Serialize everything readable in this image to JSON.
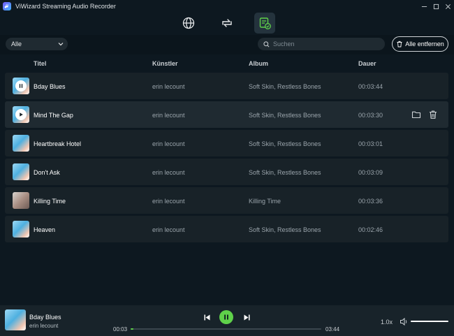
{
  "window": {
    "title": "ViWizard Streaming Audio Recorder"
  },
  "toolbar": {
    "filter_selected": "Alle",
    "search_placeholder": "Suchen",
    "remove_all_label": "Alle entfernen"
  },
  "columns": {
    "title": "Titel",
    "artist": "Künstler",
    "album": "Album",
    "duration": "Dauer"
  },
  "tracks": [
    {
      "title": "Bday Blues",
      "artist": "erin lecount",
      "album": "Soft Skin, Restless Bones",
      "duration": "00:03:44"
    },
    {
      "title": "Mind The Gap",
      "artist": "erin lecount",
      "album": "Soft Skin, Restless Bones",
      "duration": "00:03:30"
    },
    {
      "title": "Heartbreak Hotel",
      "artist": "erin lecount",
      "album": "Soft Skin, Restless Bones",
      "duration": "00:03:01"
    },
    {
      "title": "Don't Ask",
      "artist": "erin lecount",
      "album": "Soft Skin, Restless Bones",
      "duration": "00:03:09"
    },
    {
      "title": "Killing Time",
      "artist": "erin lecount",
      "album": "Killing Time",
      "duration": "00:03:36"
    },
    {
      "title": "Heaven",
      "artist": "erin lecount",
      "album": "Soft Skin, Restless Bones",
      "duration": "00:02:46"
    }
  ],
  "player": {
    "title": "Bday Blues",
    "artist": "erin lecount",
    "current_time": "00:03",
    "total_time": "03:44",
    "progress_fraction": 0.013,
    "speed": "1.0x",
    "volume_fraction": 1.0
  },
  "colors": {
    "accent": "#5fd14a",
    "background": "#0d1820",
    "row": "#182228"
  },
  "icons": [
    "globe-icon",
    "convert-icon",
    "converted-list-icon",
    "folder-icon",
    "trash-icon",
    "search-icon"
  ]
}
